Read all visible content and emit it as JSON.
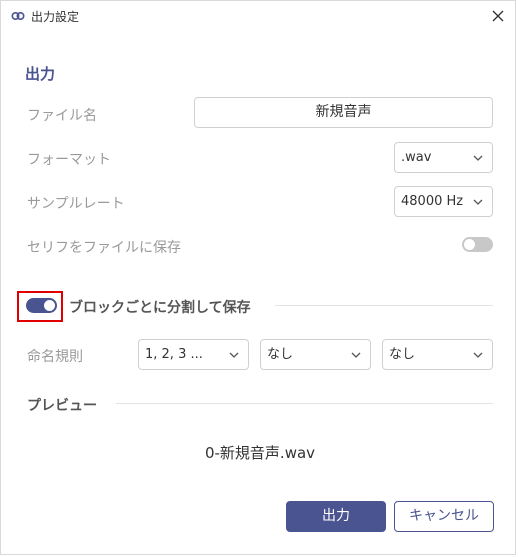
{
  "window": {
    "title": "出力設定"
  },
  "output": {
    "section_title": "出力",
    "filename_label": "ファイル名",
    "filename_value": "新規音声",
    "format_label": "フォーマット",
    "format_value": ".wav",
    "samplerate_label": "サンプルレート",
    "samplerate_value": "48000 Hz",
    "save_dialogue_label": "セリフをファイルに保存",
    "save_dialogue_enabled": false
  },
  "split": {
    "label": "ブロックごとに分割して保存",
    "enabled": true,
    "naming_label": "命名規則",
    "naming_options": [
      "1, 2, 3 ...",
      "なし",
      "なし"
    ]
  },
  "preview": {
    "title": "プレビュー",
    "text": "0-新規音声.wav"
  },
  "buttons": {
    "export": "出力",
    "cancel": "キャンセル"
  },
  "colors": {
    "accent": "#4a5490",
    "highlight": "#e00000",
    "label": "#9a9a9a"
  }
}
